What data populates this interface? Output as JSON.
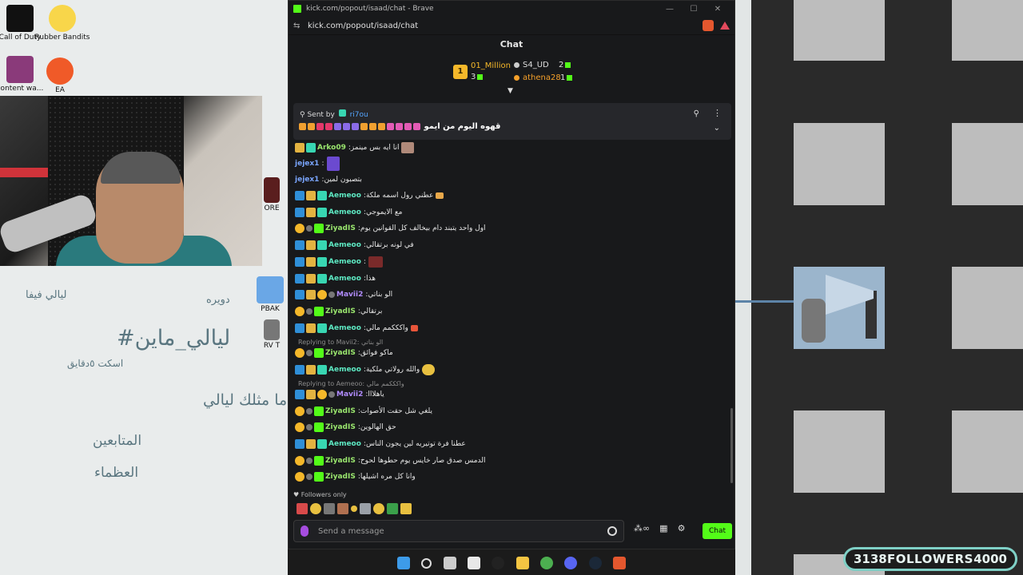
{
  "colors": {
    "kick_green": "#53fc18",
    "chat_bg": "#18191b",
    "followers_border": "#7fd0c6"
  },
  "desktop": {
    "icons": [
      {
        "label": "Call of Duty",
        "icon": "cod-icon"
      },
      {
        "label": "Rubber Bandits",
        "icon": "rubber-bandits-icon"
      },
      {
        "label": "content wa...",
        "icon": "content-icon"
      },
      {
        "label": "EA",
        "icon": "ea-icon"
      },
      {
        "label": "PBAK",
        "icon": "pbak-icon"
      },
      {
        "label": "RV T",
        "icon": "rvt-icon"
      },
      {
        "label": "ORE",
        "icon": "ore-icon"
      }
    ],
    "notes": [
      {
        "text": "ليالي فيفا"
      },
      {
        "text": "دويره"
      },
      {
        "text": "#ليالي_ماين"
      },
      {
        "text": "اسكت ٥دقايق"
      },
      {
        "text": "ما مثلك ليالي"
      },
      {
        "text": "المتابعين"
      },
      {
        "text": "العظماء"
      }
    ]
  },
  "followers_widget": {
    "current": "3138",
    "label": "FOLLOWERS",
    "goal": "4000"
  },
  "browser": {
    "title": "kick.com/popout/isaad/chat - Brave",
    "url": "kick.com/popout/isaad/chat"
  },
  "chat": {
    "header": "Chat",
    "leaderboard": [
      {
        "rank": "1",
        "name": "01_Million",
        "gifts": "3"
      },
      {
        "name": "S4_UD",
        "gifts": "2"
      },
      {
        "name": "athena28",
        "gifts": "1"
      }
    ],
    "pinned": {
      "sent_by_label": "Sent by",
      "sender": "ri7ou",
      "message": "قهوه اليوم من ايمو"
    },
    "messages": [
      {
        "user": "Arko09",
        "text": "انا ايه بس مينمز",
        "color": "green"
      },
      {
        "user": "jejex1",
        "text": "",
        "color": "blue"
      },
      {
        "user": "jejex1",
        "text": "بتصبون لمين",
        "color": "blue"
      },
      {
        "user": "Aemeoo",
        "text": "عطني رول اسمه ملكة",
        "color": "teal"
      },
      {
        "user": "Aemeoo",
        "text": "مع الايموجي",
        "color": "teal"
      },
      {
        "user": "ZiyadIS",
        "text": "اول واحد يتبند دام بيخالف كل القوانين يوم",
        "color": "green"
      },
      {
        "user": "Aemeoo",
        "text": "في لونه برتقالي",
        "color": "teal"
      },
      {
        "user": "Aemeoo",
        "text": "",
        "color": "teal"
      },
      {
        "user": "Aemeoo",
        "text": "هذا",
        "color": "teal"
      },
      {
        "user": "Mavii2",
        "text": "الو بناتي",
        "color": "purple"
      },
      {
        "user": "ZiyadIS",
        "text": "برتقالي",
        "color": "green"
      },
      {
        "user": "Aemeoo",
        "text": "واكككمم مالي",
        "color": "teal"
      },
      {
        "reply": "Replying to Mavii2: الو بناتي",
        "user": "ZiyadIS",
        "text": "ماكو فوائق",
        "color": "green"
      },
      {
        "user": "Aemeoo",
        "text": "والله رولاتي ملكية",
        "color": "teal"
      },
      {
        "reply": "Replying to Aemeoo: واكككمم مالي",
        "user": "Mavii2",
        "text": "ياهلااا",
        "color": "purple"
      },
      {
        "user": "ZiyadIS",
        "text": "يلغي شل حقت الأصوات",
        "color": "green"
      },
      {
        "user": "ZiyadIS",
        "text": "حق الهالوين",
        "color": "green"
      },
      {
        "user": "Aemeoo",
        "text": "عطنا فرة توتيريه لين يجون الناس",
        "color": "teal"
      },
      {
        "user": "ZiyadIS",
        "text": "الدمس صدق صار خايس يوم حطوها لحوح",
        "color": "green"
      },
      {
        "user": "ZiyadIS",
        "text": "وانا كل مره اشيلها",
        "color": "green"
      }
    ],
    "followers_only": "Followers only",
    "input_placeholder": "Send a message",
    "send_label": "Chat"
  }
}
